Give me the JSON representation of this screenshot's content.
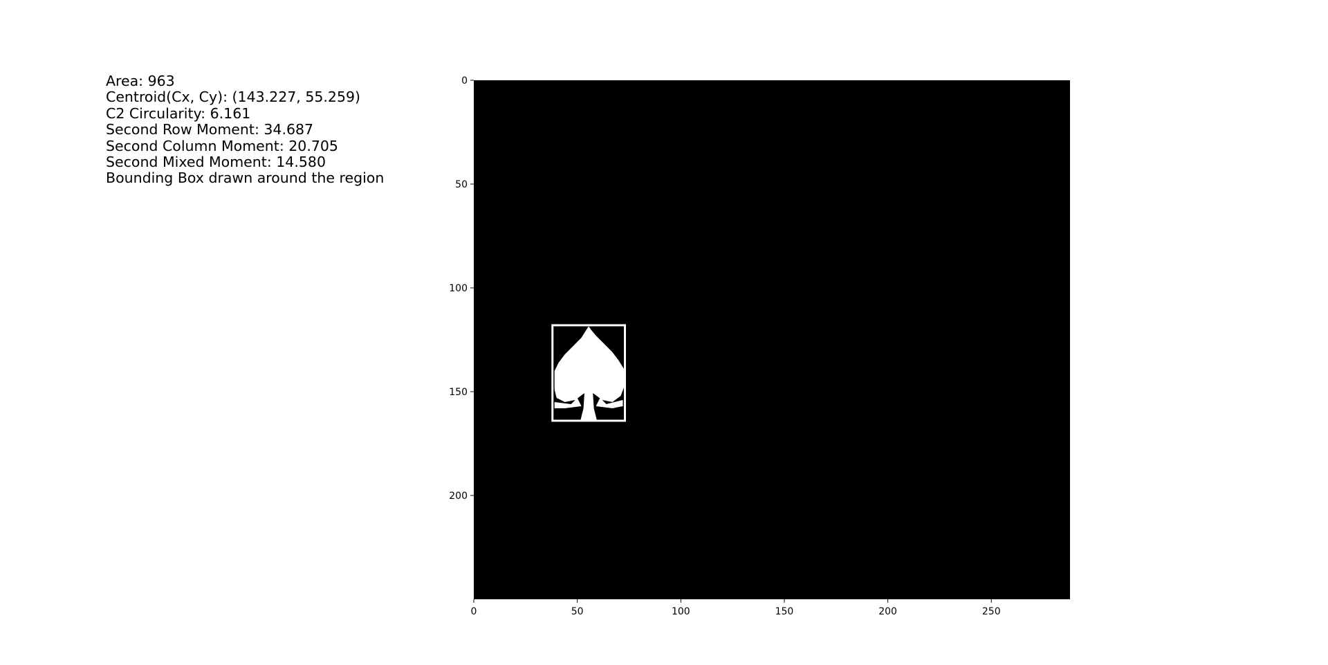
{
  "stats": {
    "area": "Area: 963",
    "centroid": "Centroid(Cx, Cy): (143.227, 55.259)",
    "circularity": "C2 Circularity: 6.161",
    "row_moment": "Second Row Moment: 34.687",
    "col_moment": "Second Column Moment: 20.705",
    "mixed_moment": "Second Mixed Moment: 14.580",
    "note": "Bounding Box drawn around the region"
  },
  "chart_data": {
    "type": "image",
    "title": "",
    "xlabel": "",
    "ylabel": "",
    "xlim": [
      0,
      288
    ],
    "ylim": [
      250,
      0
    ],
    "xticks": [
      0,
      50,
      100,
      150,
      200,
      250
    ],
    "yticks": [
      0,
      50,
      100,
      150,
      200
    ],
    "background_color": "#000000",
    "foreground_color": "#ffffff",
    "grid": false,
    "region": {
      "shape": "spade",
      "bbox": {
        "xmin": 38,
        "xmax": 73,
        "ymin": 118,
        "ymax": 164
      }
    }
  }
}
